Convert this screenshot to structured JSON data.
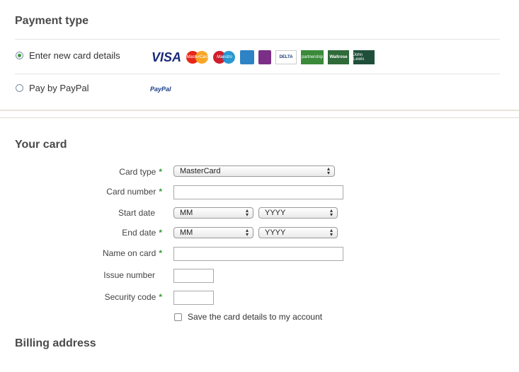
{
  "payment_type": {
    "heading": "Payment type",
    "options": [
      {
        "label": "Enter new card details",
        "selected": true
      },
      {
        "label": "Pay by PayPal",
        "selected": false
      }
    ],
    "card_logos": [
      "visa",
      "mastercard",
      "maestro",
      "american-express",
      "solo",
      "delta",
      "partnership-card",
      "waitrose-account-card",
      "john-lewis-account-card"
    ],
    "visa_text": "VISA",
    "mastercard_text": "MasterCard",
    "maestro_text": "Maestro",
    "delta_text": "DELTA",
    "waitrose_text": "Waitrose",
    "johnlewis_text": "John Lewis",
    "partnership_text": "partnership",
    "paypal_logo_text": "PayPal"
  },
  "your_card": {
    "heading": "Your card",
    "card_type": {
      "label": "Card type",
      "value": "MasterCard"
    },
    "card_number": {
      "label": "Card number",
      "value": ""
    },
    "start_date": {
      "label": "Start date",
      "month": "MM",
      "year": "YYYY"
    },
    "end_date": {
      "label": "End date",
      "month": "MM",
      "year": "YYYY"
    },
    "name_on_card": {
      "label": "Name on card",
      "value": ""
    },
    "issue_number": {
      "label": "Issue number",
      "value": ""
    },
    "security_code": {
      "label": "Security code",
      "value": ""
    },
    "save_card": {
      "label": "Save the card details to my account",
      "checked": false
    },
    "required_marker": "*"
  },
  "billing": {
    "heading": "Billing address"
  },
  "colors": {
    "required": "#3a9a3a",
    "radio_selected": "#3a9a3a"
  }
}
